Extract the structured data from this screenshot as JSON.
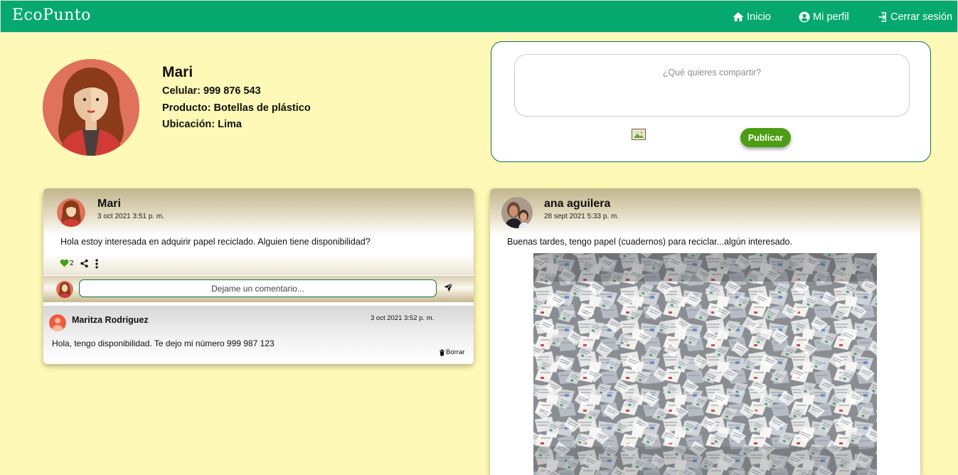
{
  "navbar": {
    "brand": "EcoPunto",
    "links": [
      {
        "label": "Inicio",
        "icon": "home-icon"
      },
      {
        "label": "Mi perfil",
        "icon": "user-circle-icon"
      },
      {
        "label": "Cerrar sesión",
        "icon": "logout-icon"
      }
    ]
  },
  "profile": {
    "name": "Mari",
    "phone": "Celular: 999 876 543",
    "product": "Producto: Botellas de plástico",
    "location": "Ubicación: Lima"
  },
  "composer": {
    "placeholder": "¿Qué quieres compartir?",
    "publish_label": "Publicar"
  },
  "posts": [
    {
      "user": "Mari",
      "date": "3 oct 2021 3:51 p. m.",
      "text": "Hola estoy interesada en adquirir papel reciclado. Alguien tiene disponibilidad?",
      "likes": "2",
      "comment_placeholder": "Dejame un comentario...",
      "comments": [
        {
          "user": "Maritza Rodriguez",
          "date": "3 oct 2021 3:52 p. m.",
          "text": "Hola, tengo disponibilidad. Te dejo mi número 999 987 123",
          "delete_label": "Borrar"
        }
      ]
    },
    {
      "user": "ana aguilera",
      "date": "28 sept 2021 5:33 p. m.",
      "text": "Buenas tardes, tengo papel (cuadernos) para reciclar...algún interesado."
    }
  ],
  "colors": {
    "background": "#fef9b6",
    "navbar": "#05a96f",
    "publish_button": "#4c9d13",
    "like_heart": "#4c9d13",
    "card_header": "#c2b58d"
  }
}
